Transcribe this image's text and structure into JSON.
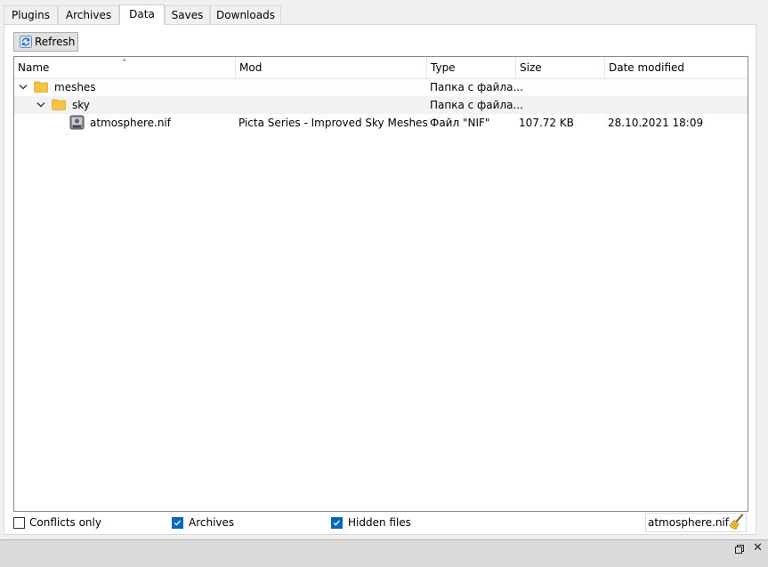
{
  "tabs": [
    {
      "label": "Plugins",
      "active": false
    },
    {
      "label": "Archives",
      "active": false
    },
    {
      "label": "Data",
      "active": true
    },
    {
      "label": "Saves",
      "active": false
    },
    {
      "label": "Downloads",
      "active": false
    }
  ],
  "toolbar": {
    "refresh_label": "Refresh",
    "refresh_icon": "refresh-icon"
  },
  "tree": {
    "columns": [
      "Name",
      "Mod",
      "Type",
      "Size",
      "Date modified"
    ],
    "sort_column": "Name",
    "rows": [
      {
        "name": "meshes",
        "mod": "",
        "type": "Папка с файла...",
        "size": "",
        "date": "",
        "icon": "folder-icon",
        "expanded": true
      },
      {
        "name": "sky",
        "mod": "",
        "type": "Папка с файла...",
        "size": "",
        "date": "",
        "icon": "folder-icon",
        "expanded": true
      },
      {
        "name": "atmosphere.nif",
        "mod": "Picta Series - Improved Sky Meshes",
        "type": "Файл \"NIF\"",
        "size": "107.72 KB",
        "date": "28.10.2021 18:09",
        "icon": "nif-file-icon"
      }
    ]
  },
  "filters": {
    "conflicts_only": {
      "label": "Conflicts only",
      "checked": false
    },
    "archives": {
      "label": "Archives",
      "checked": true
    },
    "hidden_files": {
      "label": "Hidden files",
      "checked": true
    },
    "filter_value": "atmosphere.nif",
    "clear_icon": "broom-icon"
  },
  "statusbar": {
    "icons": [
      "restore-icon",
      "close-icon"
    ]
  },
  "colors": {
    "checkbox_accent": "#0067c0",
    "folder": "#f4c542",
    "row_alt": "#f2f2f2"
  }
}
